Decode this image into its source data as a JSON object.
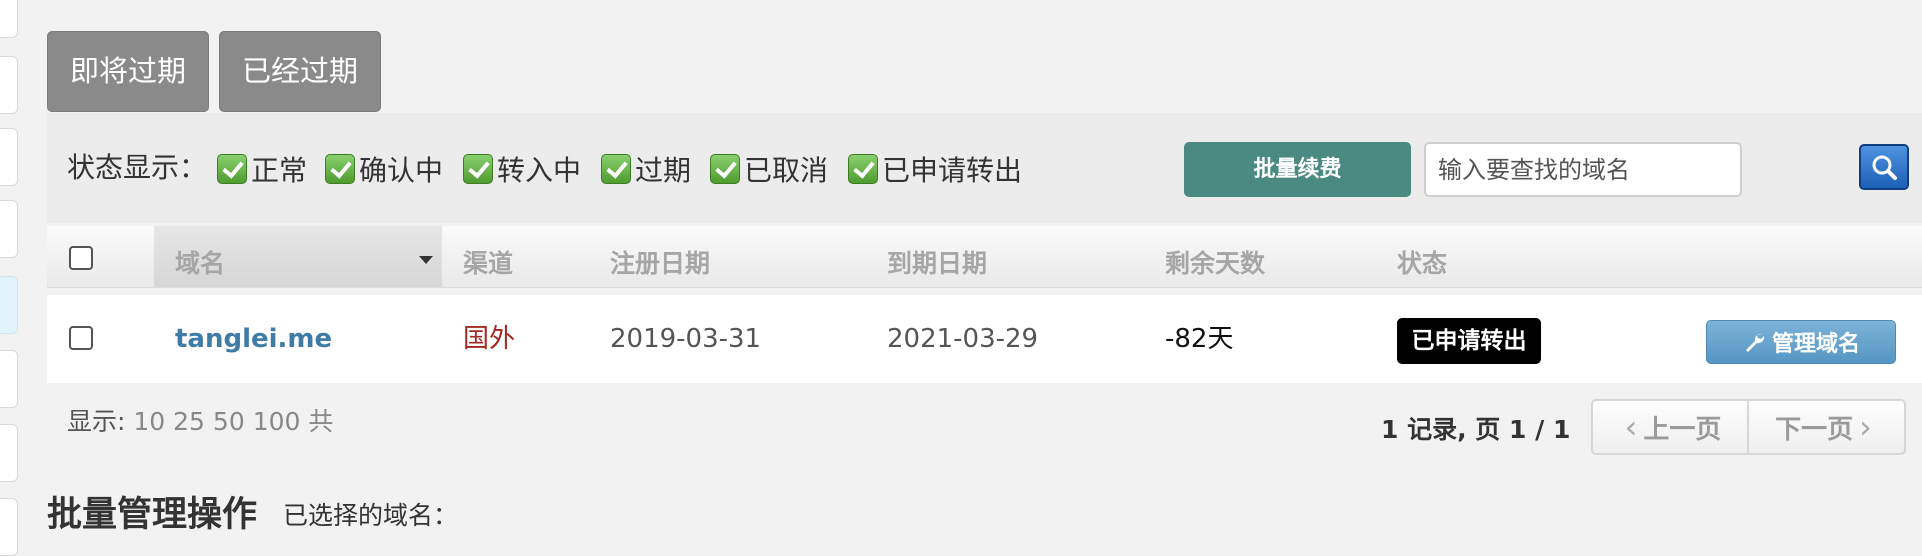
{
  "tabs": [
    {
      "label": "即将过期"
    },
    {
      "label": "已经过期"
    }
  ],
  "toolbar": {
    "status_label": "状态显示：",
    "status_options": [
      {
        "label": "正常",
        "checked": true
      },
      {
        "label": "确认中",
        "checked": true
      },
      {
        "label": "转入中",
        "checked": true
      },
      {
        "label": "过期",
        "checked": true
      },
      {
        "label": "已取消",
        "checked": true
      },
      {
        "label": "已申请转出",
        "checked": true
      }
    ],
    "bulk_renew_label": "批量续费",
    "search_placeholder": "输入要查找的域名",
    "search_icon": "search-icon"
  },
  "table": {
    "headers": {
      "domain": "域名",
      "channel": "渠道",
      "reg_date": "注册日期",
      "exp_date": "到期日期",
      "days_left": "剩余天数",
      "status": "状态"
    },
    "sorted_column": "domain",
    "rows": [
      {
        "domain": "tanglei.me",
        "channel": "国外",
        "reg_date": "2019-03-31",
        "exp_date": "2021-03-29",
        "days_left": "-82天",
        "status": "已申请转出",
        "action_label": "管理域名",
        "action_icon": "wrench-icon"
      }
    ]
  },
  "footer": {
    "show_label": "显示:",
    "page_sizes": [
      "10",
      "25",
      "50",
      "100"
    ],
    "show_suffix": "共",
    "records_text": "1 记录, 页",
    "page_current": "1",
    "page_sep": "/",
    "page_total": "1",
    "prev_label": "上一页",
    "next_label": "下一页"
  },
  "batch": {
    "title": "批量管理操作",
    "selected_label": "已选择的域名："
  },
  "colors": {
    "tab_bg": "#8a8a8a",
    "bulk_renew_bg": "#4a8a80",
    "link": "#3e7ca6",
    "channel": "#a32a20",
    "badge_bg": "#000000",
    "manage_bg": "#6aa5cd"
  }
}
